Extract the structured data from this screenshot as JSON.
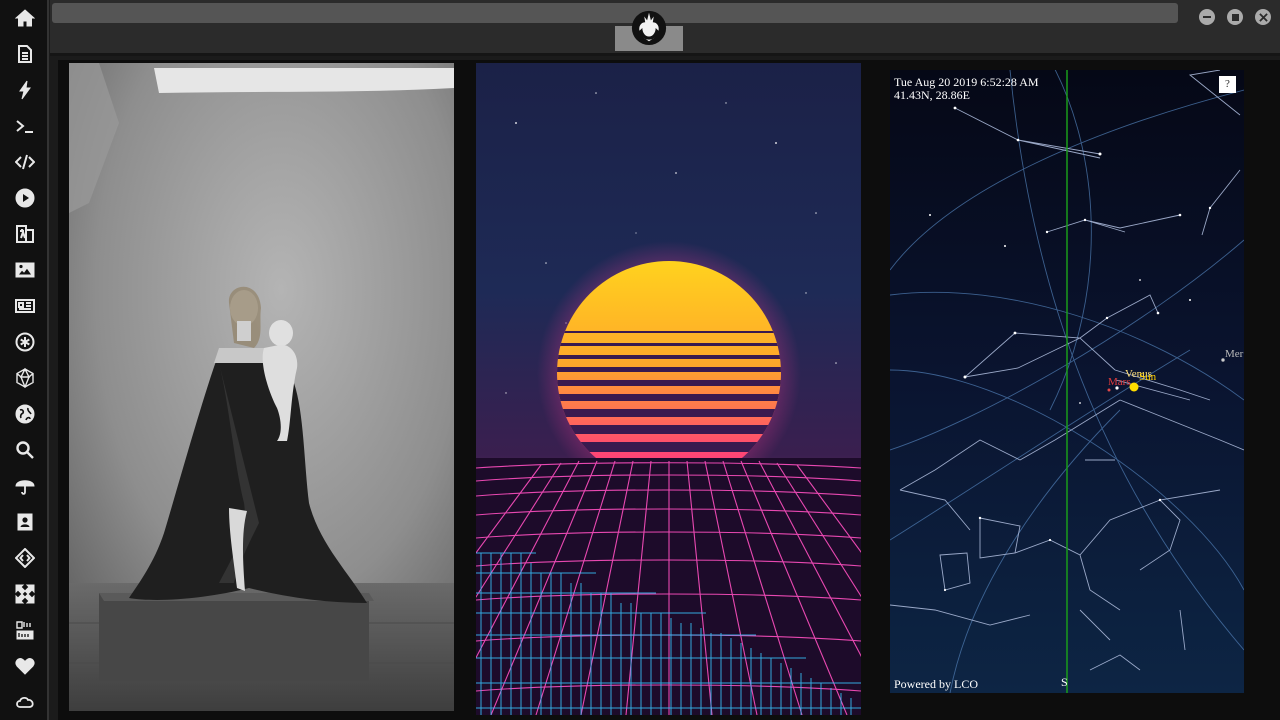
{
  "sidebar": {
    "items": [
      {
        "icon": "home-icon"
      },
      {
        "icon": "document-icon"
      },
      {
        "icon": "lightning-icon"
      },
      {
        "icon": "terminal-icon"
      },
      {
        "icon": "code-icon"
      },
      {
        "icon": "play-icon"
      },
      {
        "icon": "translate-icon"
      },
      {
        "icon": "image-icon"
      },
      {
        "icon": "newspaper-icon"
      },
      {
        "icon": "asterisk-icon"
      },
      {
        "icon": "polyhedron-icon"
      },
      {
        "icon": "globe-icon"
      },
      {
        "icon": "search-icon"
      },
      {
        "icon": "umbrella-icon"
      },
      {
        "icon": "contact-icon"
      },
      {
        "icon": "diamond-code-icon"
      },
      {
        "icon": "fullscreen-icon"
      },
      {
        "icon": "youtube-icon"
      },
      {
        "icon": "heart-icon"
      },
      {
        "icon": "cloud-icon"
      }
    ]
  },
  "topbar": {
    "logo_icon": "rebel-alliance-icon",
    "window_controls": [
      "minimize-icon",
      "maximize-icon",
      "close-icon"
    ]
  },
  "sky_map": {
    "datetime": "Tue Aug 20 2019 6:52:28 AM",
    "location": "41.43N, 28.86E",
    "help_label": "?",
    "powered_by": "Powered by LCO",
    "direction_label": "S",
    "planets": {
      "venus": "Venus",
      "sun": "Sun",
      "mars": "Mars",
      "mercury": "Mer"
    }
  },
  "colors": {
    "sidebar_bg": "#111111",
    "topbar_bg": "#2b2b2b",
    "sun_gradient_top": "#ffd21e",
    "sun_gradient_bottom": "#ff2d8c",
    "grid_pink": "#ff4fc0",
    "grid_blue": "#37c4ff",
    "meridian": "#1a9c1a"
  }
}
